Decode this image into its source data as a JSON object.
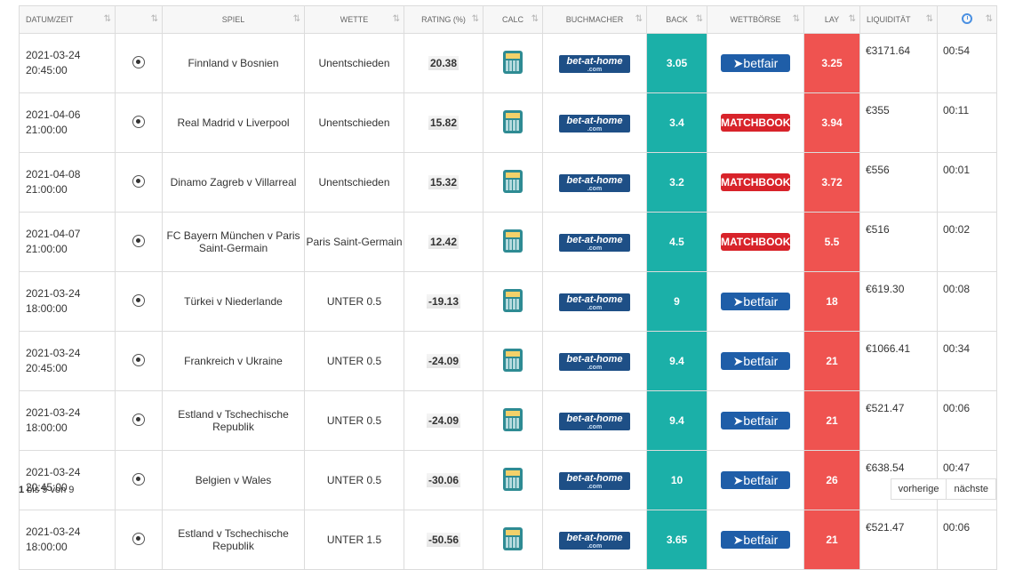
{
  "headers": {
    "date": "DATUM/ZEIT",
    "sport": "",
    "game": "SPIEL",
    "bet": "WETTE",
    "rating": "RATING (%)",
    "calc": "CALC",
    "bookmaker": "BUCHMACHER",
    "back": "BACK",
    "exchange": "WETTBÖRSE",
    "lay": "LAY",
    "liquidity": "LIQUIDITÄT",
    "time_icon": "clock-icon",
    "sort_icon": "⇅"
  },
  "colors": {
    "back": "#1bb0a8",
    "lay": "#ef5350",
    "betfair": "#1f5ea8",
    "matchbook": "#d8232a",
    "bet_at_home": "#1e4f86"
  },
  "bookmaker_logo": {
    "text": "bet-at-home",
    "sub": ".com"
  },
  "exchanges": {
    "betfair": "➤betfair",
    "matchbook": "MATCHBOOK"
  },
  "rows": [
    {
      "date": "2021-03-24",
      "time": "20:45:00",
      "game": "Finnland v Bosnien",
      "bet": "Unentschieden",
      "rating": "20.38",
      "back": "3.05",
      "exchange": "betfair",
      "exchange_label": "➤betfair",
      "lay": "3.25",
      "liquidity": "€3171.64",
      "remaining": "00:54"
    },
    {
      "date": "2021-04-06",
      "time": "21:00:00",
      "game": "Real Madrid v Liverpool",
      "bet": "Unentschieden",
      "rating": "15.82",
      "back": "3.4",
      "exchange": "matchbook",
      "exchange_label": "MATCHBOOK",
      "lay": "3.94",
      "liquidity": "€355",
      "remaining": "00:11"
    },
    {
      "date": "2021-04-08",
      "time": "21:00:00",
      "game": "Dinamo Zagreb v Villarreal",
      "bet": "Unentschieden",
      "rating": "15.32",
      "back": "3.2",
      "exchange": "matchbook",
      "exchange_label": "MATCHBOOK",
      "lay": "3.72",
      "liquidity": "€556",
      "remaining": "00:01"
    },
    {
      "date": "2021-04-07",
      "time": "21:00:00",
      "game": "FC Bayern München v Paris Saint-Germain",
      "bet": "Paris Saint-Germain",
      "rating": "12.42",
      "back": "4.5",
      "exchange": "matchbook",
      "exchange_label": "MATCHBOOK",
      "lay": "5.5",
      "liquidity": "€516",
      "remaining": "00:02"
    },
    {
      "date": "2021-03-24",
      "time": "18:00:00",
      "game": "Türkei v Niederlande",
      "bet": "UNTER 0.5",
      "rating": "-19.13",
      "back": "9",
      "exchange": "betfair",
      "exchange_label": "➤betfair",
      "lay": "18",
      "liquidity": "€619.30",
      "remaining": "00:08"
    },
    {
      "date": "2021-03-24",
      "time": "20:45:00",
      "game": "Frankreich v Ukraine",
      "bet": "UNTER 0.5",
      "rating": "-24.09",
      "back": "9.4",
      "exchange": "betfair",
      "exchange_label": "➤betfair",
      "lay": "21",
      "liquidity": "€1066.41",
      "remaining": "00:34"
    },
    {
      "date": "2021-03-24",
      "time": "18:00:00",
      "game": "Estland v Tschechische Republik",
      "bet": "UNTER 0.5",
      "rating": "-24.09",
      "back": "9.4",
      "exchange": "betfair",
      "exchange_label": "➤betfair",
      "lay": "21",
      "liquidity": "€521.47",
      "remaining": "00:06"
    },
    {
      "date": "2021-03-24",
      "time": "20:45:00",
      "game": "Belgien v Wales",
      "bet": "UNTER 0.5",
      "rating": "-30.06",
      "back": "10",
      "exchange": "betfair",
      "exchange_label": "➤betfair",
      "lay": "26",
      "liquidity": "€638.54",
      "remaining": "00:47"
    },
    {
      "date": "2021-03-24",
      "time": "18:00:00",
      "game": "Estland v Tschechische Republik",
      "bet": "UNTER 1.5",
      "rating": "-50.56",
      "back": "3.65",
      "exchange": "betfair",
      "exchange_label": "➤betfair",
      "lay": "21",
      "liquidity": "€521.47",
      "remaining": "00:06"
    }
  ],
  "footer": {
    "info_from": "1",
    "info_rest": " bis 9 von 9",
    "prev": "vorherige",
    "next": "nächste"
  }
}
